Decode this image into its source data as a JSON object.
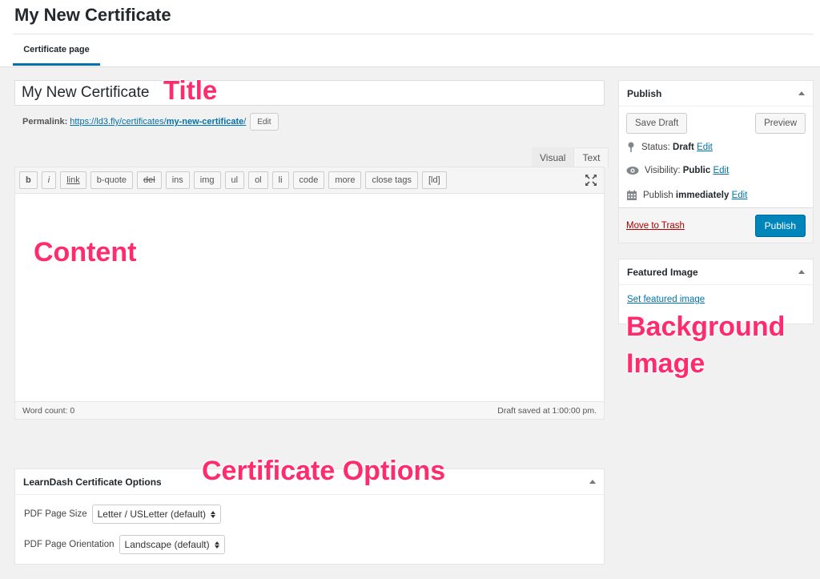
{
  "header": {
    "title": "My New Certificate",
    "tab": "Certificate page"
  },
  "editor": {
    "title_value": "My New Certificate",
    "permalink_label": "Permalink:",
    "permalink_url_base": "https://ld3.fly/certificates/",
    "permalink_slug": "my-new-certificate",
    "permalink_trailing": "/",
    "permalink_edit": "Edit",
    "tab_visual": "Visual",
    "tab_text": "Text",
    "toolbar_buttons": [
      "b",
      "i",
      "link",
      "b-quote",
      "del",
      "ins",
      "img",
      "ul",
      "ol",
      "li",
      "code",
      "more",
      "close tags",
      "[ld]"
    ],
    "word_count": "Word count: 0",
    "draft_saved": "Draft saved at 1:00:00 pm."
  },
  "annotations": {
    "title": "Title",
    "content": "Content",
    "background_line1": "Background",
    "background_line2": "Image",
    "options": "Certificate Options"
  },
  "publish": {
    "heading": "Publish",
    "save_draft": "Save Draft",
    "preview": "Preview",
    "status_label": "Status:",
    "status_value": "Draft",
    "visibility_label": "Visibility:",
    "visibility_value": "Public",
    "publish_label": "Publish",
    "publish_value": "immediately",
    "edit": "Edit",
    "move_to_trash": "Move to Trash",
    "publish_button": "Publish"
  },
  "featured": {
    "heading": "Featured Image",
    "set_link": "Set featured image"
  },
  "options": {
    "heading": "LearnDash Certificate Options",
    "page_size_label": "PDF Page Size",
    "page_size_value": "Letter / USLetter (default)",
    "orientation_label": "PDF Page Orientation",
    "orientation_value": "Landscape (default)"
  },
  "colors": {
    "accent": "#0073aa",
    "publish_button": "#0085ba",
    "annotation": "#ff2c6d",
    "trash": "#a00000"
  }
}
